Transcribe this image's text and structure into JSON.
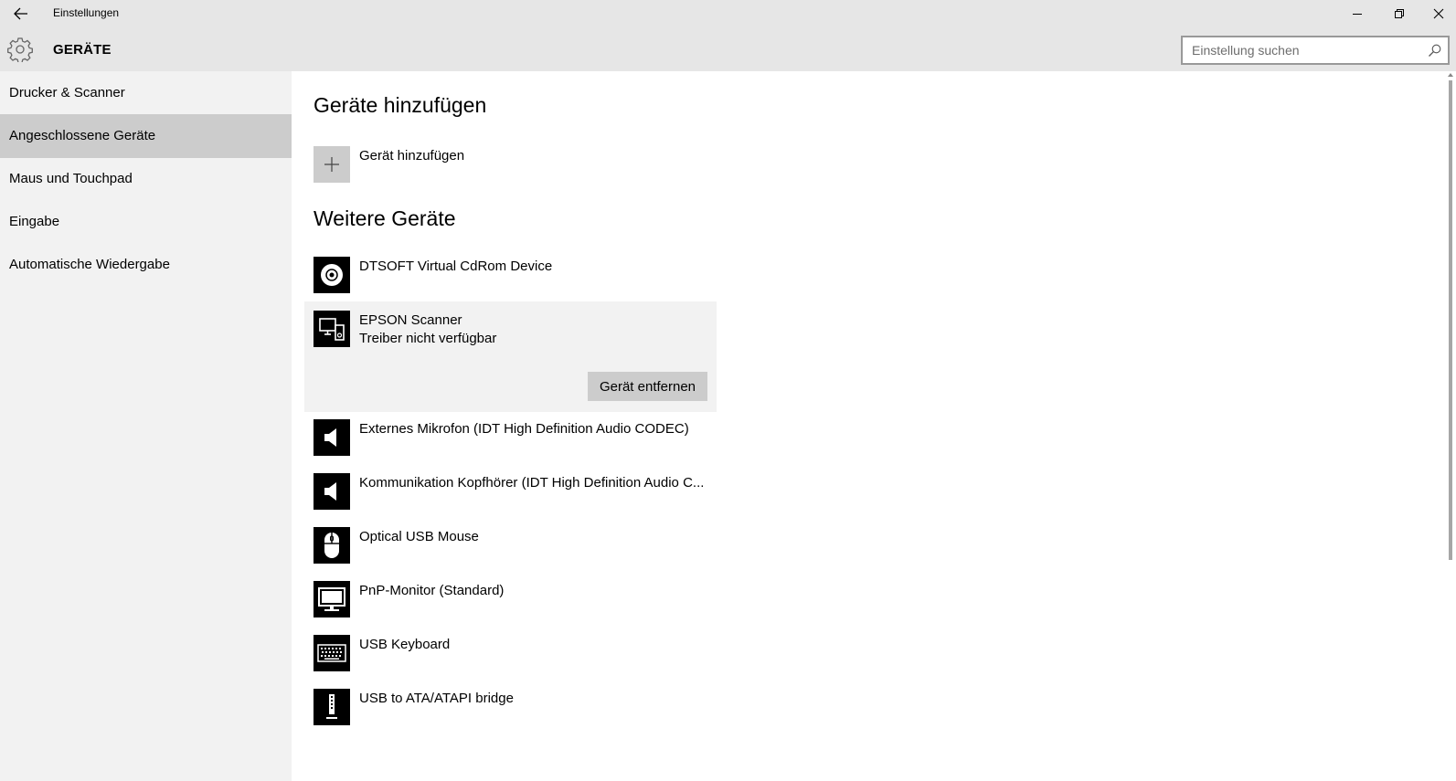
{
  "window": {
    "title": "Einstellungen",
    "icons": {
      "back": "back-arrow-icon",
      "minimize": "minimize-icon",
      "maximize": "restore-icon",
      "close": "close-icon"
    }
  },
  "header": {
    "title": "GERÄTE",
    "icon": "gear-icon",
    "search": {
      "placeholder": "Einstellung suchen",
      "value": "",
      "icon": "search-icon"
    }
  },
  "sidebar": {
    "items": [
      {
        "label": "Drucker & Scanner",
        "selected": false
      },
      {
        "label": "Angeschlossene Geräte",
        "selected": true
      },
      {
        "label": "Maus und Touchpad",
        "selected": false
      },
      {
        "label": "Eingabe",
        "selected": false
      },
      {
        "label": "Automatische Wiedergabe",
        "selected": false
      }
    ]
  },
  "main": {
    "add_section": {
      "heading": "Geräte hinzufügen",
      "add_label": "Gerät hinzufügen",
      "add_icon": "plus-icon"
    },
    "devices_section": {
      "heading": "Weitere Geräte",
      "devices": [
        {
          "name": "DTSOFT Virtual CdRom Device",
          "icon": "disc-icon"
        },
        {
          "name": "EPSON Scanner",
          "status": "Treiber nicht verfügbar",
          "icon": "multi-device-icon",
          "selected": true,
          "action": "Gerät entfernen"
        },
        {
          "name": "Externes Mikrofon (IDT High Definition Audio CODEC)",
          "icon": "speaker-icon"
        },
        {
          "name": "Kommunikation Kopfhörer (IDT High Definition Audio C...",
          "icon": "speaker-icon"
        },
        {
          "name": "Optical USB Mouse",
          "icon": "mouse-icon"
        },
        {
          "name": "PnP-Monitor (Standard)",
          "icon": "monitor-icon"
        },
        {
          "name": "USB Keyboard",
          "icon": "keyboard-icon"
        },
        {
          "name": "USB to ATA/ATAPI bridge",
          "icon": "usb-drive-icon"
        }
      ]
    }
  },
  "colors": {
    "titlebar": "#e6e6e6",
    "sidebar": "#f2f2f2",
    "sidebar_selected": "#cccccc",
    "content": "#ffffff",
    "device_icon_bg": "#000000",
    "button": "#cccccc"
  }
}
